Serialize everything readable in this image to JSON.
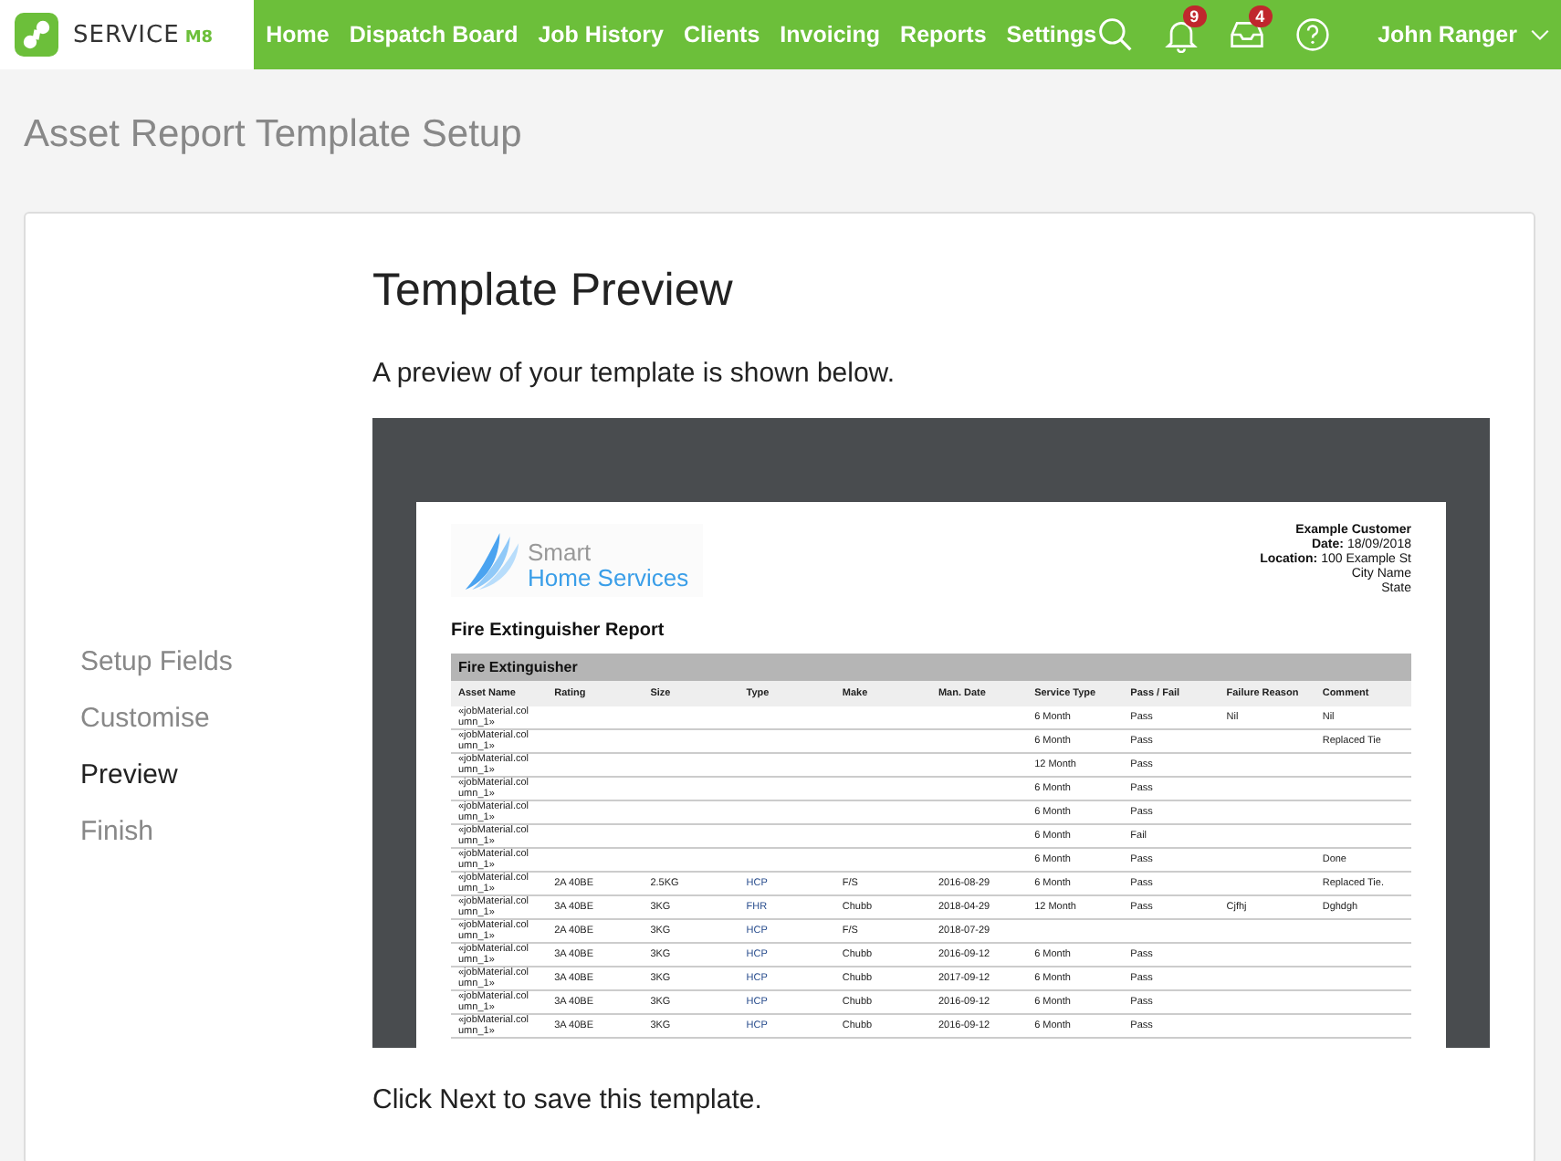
{
  "nav": {
    "logo_word": "SERVICE",
    "logo_suffix": "M8",
    "links": [
      {
        "label": "Home"
      },
      {
        "label": "Dispatch Board"
      },
      {
        "label": "Job History"
      },
      {
        "label": "Clients"
      },
      {
        "label": "Invoicing"
      },
      {
        "label": "Reports"
      },
      {
        "label": "Settings"
      }
    ],
    "notifications_count": "9",
    "inbox_count": "4",
    "user": "John Ranger"
  },
  "page_title": "Asset Report Template Setup",
  "steps": [
    {
      "label": "Setup Fields",
      "selected": false
    },
    {
      "label": "Customise",
      "selected": false
    },
    {
      "label": "Preview",
      "selected": true
    },
    {
      "label": "Finish",
      "selected": false
    }
  ],
  "heading": "Template Preview",
  "intro": "A preview of your template is shown below.",
  "preview": {
    "brand_top": "Smart",
    "brand_bottom": "Home Services",
    "customer": [
      "Example Customer"
    ],
    "details": [
      {
        "label": "Date:",
        "value": "18/09/2018"
      },
      {
        "label": "Location:",
        "value": "100 Example St"
      }
    ],
    "address_lines": [
      "City Name",
      "State"
    ],
    "report_title": "Fire Extinguisher Report",
    "section": "Fire Extinguisher",
    "columns": [
      "Asset Name",
      "Rating",
      "Size",
      "Type",
      "Make",
      "Man. Date",
      "Service Type",
      "Pass / Fail",
      "Failure Reason",
      "Comment"
    ],
    "rows": [
      [
        "«jobMaterial.column_1»",
        null,
        null,
        null,
        null,
        null,
        "6 Month",
        "Pass",
        "Nil",
        "Nil"
      ],
      [
        "«jobMaterial.column_1»",
        null,
        null,
        null,
        null,
        null,
        "6 Month",
        "Pass",
        null,
        "Replaced Tie"
      ],
      [
        "«jobMaterial.column_1»",
        null,
        null,
        null,
        null,
        null,
        "12 Month",
        "Pass",
        null,
        null
      ],
      [
        "«jobMaterial.column_1»",
        null,
        null,
        null,
        null,
        null,
        "6 Month",
        "Pass",
        null,
        null
      ],
      [
        "«jobMaterial.column_1»",
        null,
        null,
        null,
        null,
        null,
        "6 Month",
        "Pass",
        null,
        null
      ],
      [
        "«jobMaterial.column_1»",
        null,
        null,
        null,
        null,
        null,
        "6 Month",
        "Fail",
        null,
        null
      ],
      [
        "«jobMaterial.column_1»",
        null,
        null,
        null,
        null,
        null,
        "6 Month",
        "Pass",
        null,
        "Done"
      ],
      [
        "«jobMaterial.column_1»",
        "2A 40BE",
        "2.5KG",
        "HCP",
        "F/S",
        "2016-08-29",
        "6 Month",
        "Pass",
        null,
        "Replaced Tie."
      ],
      [
        "«jobMaterial.column_1»",
        "3A 40BE",
        "3KG",
        "FHR",
        "Chubb",
        "2018-04-29",
        "12 Month",
        "Pass",
        "Cjfhj",
        "Dghdgh"
      ],
      [
        "«jobMaterial.column_1»",
        "2A 40BE",
        "3KG",
        "HCP",
        "F/S",
        "2018-07-29",
        null,
        null,
        null,
        null
      ],
      [
        "«jobMaterial.column_1»",
        "3A 40BE",
        "3KG",
        "HCP",
        "Chubb",
        "2016-09-12",
        "6 Month",
        "Pass",
        null,
        null
      ],
      [
        "«jobMaterial.column_1»",
        "3A 40BE",
        "3KG",
        "HCP",
        "Chubb",
        "2017-09-12",
        "6 Month",
        "Pass",
        null,
        null
      ],
      [
        "«jobMaterial.column_1»",
        "3A 40BE",
        "3KG",
        "HCP",
        "Chubb",
        "2016-09-12",
        "6 Month",
        "Pass",
        null,
        null
      ],
      [
        "«jobMaterial.column_1»",
        "3A 40BE",
        "3KG",
        "HCP",
        "Chubb",
        "2016-09-12",
        "6 Month",
        "Pass",
        null,
        null
      ]
    ]
  },
  "footer_note": "Click Next to save this template."
}
